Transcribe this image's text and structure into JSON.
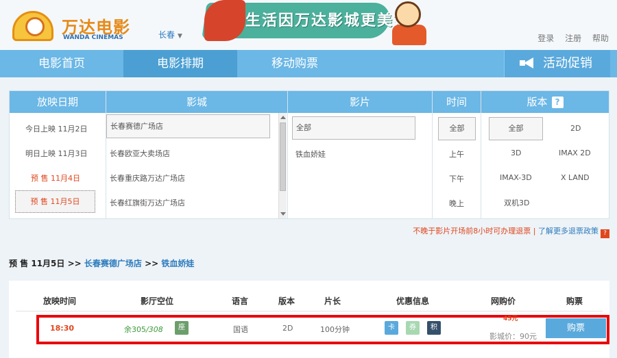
{
  "header": {
    "logo_cn": "万达电影",
    "logo_en": "WANDA CINEMAS",
    "city": "长春",
    "banner_slogan": "生活因万达影城更美好",
    "links": [
      "登录",
      "注册",
      "帮助"
    ]
  },
  "nav": {
    "items": [
      "电影首页",
      "电影排期",
      "移动购票"
    ],
    "active": "电影排期",
    "promo": "活动促销"
  },
  "filter": {
    "headers": {
      "date": "放映日期",
      "cinema": "影城",
      "movie": "影片",
      "time": "时间",
      "version": "版本",
      "version_help": "?"
    },
    "dates": [
      "今日上映 11月2日",
      "明日上映 11月3日",
      "预 售 11月4日",
      "预 售 11月5日"
    ],
    "cinemas": [
      "长春赛德广场店",
      "长春欧亚大卖场店",
      "长春重庆路万达广场店",
      "长春红旗街万达广场店"
    ],
    "movies": [
      "全部",
      "铁血娇娃"
    ],
    "times": [
      "全部",
      "上午",
      "下午",
      "晚上"
    ],
    "versions": [
      "全部",
      "2D",
      "3D",
      "IMAX 2D",
      "IMAX-3D",
      "X LAND",
      "双机3D"
    ]
  },
  "refund_notice": {
    "text": "不晚于影片开场前8小时可办理退票 |",
    "more": "了解更多退票政策",
    "icon": "?"
  },
  "breadcrumb": {
    "date": "预 售  11月5日",
    "sep": ">>",
    "cinema": "长春赛德广场店",
    "movie": "铁血娇娃"
  },
  "table": {
    "headers": [
      "放映时间",
      "影厅空位",
      "语言",
      "版本",
      "片长",
      "优惠信息",
      "网购价",
      "购票"
    ],
    "rows": [
      {
        "time": "18:30",
        "seats_left": "余305",
        "seats_total": "/308",
        "hall_icon": "座",
        "language": "国语",
        "version": "2D",
        "duration": "100分钟",
        "promos": [
          "卡",
          "券",
          "积"
        ],
        "price": "45元",
        "cinema_price": "影城价：90元",
        "buy_label": "购票"
      }
    ]
  },
  "colors": {
    "nav_blue": "#6bb7e6",
    "accent_red": "#e0461d",
    "highlight_border": "#e8070d"
  }
}
